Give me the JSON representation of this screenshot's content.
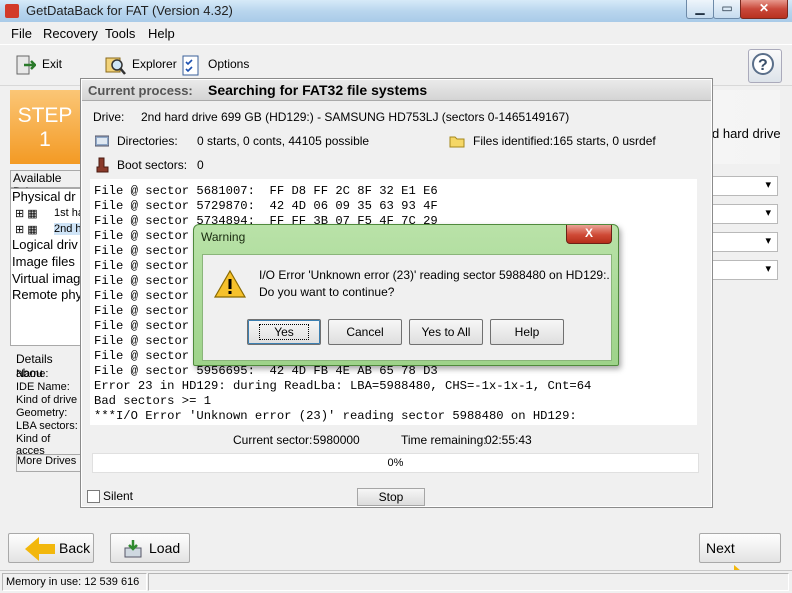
{
  "window": {
    "title": "GetDataBack for FAT (Version 4.32)"
  },
  "menu": [
    "File",
    "Recovery",
    "Tools",
    "Help"
  ],
  "toolbar": {
    "exit": "Exit",
    "explorer": "Explorer",
    "options": "Options",
    "help_icon": "?"
  },
  "wizard": {
    "step_word": "STEP",
    "step_num": "1",
    "right_text": "d hard drive",
    "available_drives": "Available Drive",
    "tree": [
      "Physical dr",
      "1st ha",
      "2nd h",
      "Logical driv",
      "Image files",
      "Virtual imag",
      "Remote phy"
    ],
    "details_title": "Details abou",
    "details_labels": [
      "Name:",
      "IDE Name:",
      "Kind of drive",
      "Geometry:",
      "LBA sectors:",
      "Kind of acces"
    ],
    "more_drives": "More Drives"
  },
  "process": {
    "label": "Current process:",
    "value": "Searching for FAT32 file systems",
    "drive_label": "Drive:",
    "drive_value": "2nd hard drive 699 GB (HD129:) - SAMSUNG HD753LJ (sectors 0-1465149167)",
    "dirs_label": "Directories:",
    "dirs_value": "0 starts, 0 conts, 44105 possible",
    "files_label": "Files identified:",
    "files_value": "165 starts, 0 usrdef",
    "boot_label": "Boot sectors:",
    "boot_value": "0",
    "log": [
      "File @ sector 5681007:  FF D8 FF 2C 8F 32 E1 E6",
      "File @ sector 5729870:  42 4D 06 09 35 63 93 4F",
      "File @ sector 5734894:  FF FF 3B 07 F5 4F 7C 29",
      "File @ sector",
      "File @ sector",
      "File @ sector",
      "File @ sector",
      "File @ sector",
      "File @ sector",
      "File @ sector",
      "File @ sector",
      "File @ sector",
      "File @ sector 5956695:  42 4D FB 4E AB 65 78 D3",
      "Error 23 in HD129: during ReadLba: LBA=5988480, CHS=-1x-1x-1, Cnt=64",
      "Bad sectors >= 1",
      "***I/O Error 'Unknown error (23)' reading sector 5988480 on HD129:"
    ],
    "current_sector_label": "Current sector:",
    "current_sector_value": "5980000",
    "time_remaining_label": "Time remaining:",
    "time_remaining_value": "02:55:43",
    "progress_text": "0%",
    "progress_value": 0,
    "silent_label": "Silent",
    "stop_label": "Stop"
  },
  "dialog": {
    "title": "Warning",
    "close": "X",
    "message_line1": "I/O Error 'Unknown error (23)' reading sector 5988480 on HD129:.",
    "message_line2": "Do you want to continue?",
    "buttons": [
      "Yes",
      "Cancel",
      "Yes to All",
      "Help"
    ]
  },
  "nav": {
    "back": "Back",
    "load": "Load",
    "next": "Next"
  },
  "status": {
    "memory": "Memory in use: 12 539 616"
  },
  "colors": {
    "step_orange": "#f39a24",
    "dialog_green": "#9ed38a",
    "arrow_yellow": "#f2b70c"
  }
}
